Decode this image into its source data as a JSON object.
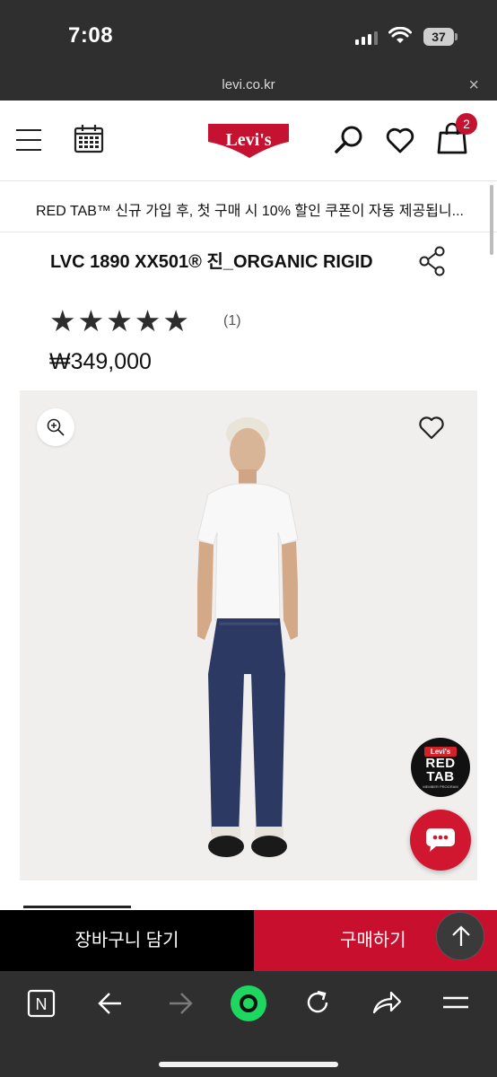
{
  "status_bar": {
    "time": "7:08",
    "battery": "37"
  },
  "url_bar": {
    "domain": "levi.co.kr",
    "close": "×"
  },
  "header": {
    "logo_text": "Levi's",
    "cart_count": "2"
  },
  "promo": {
    "text": "RED TAB™ 신규 가입 후, 첫 구매 시 10% 할인 쿠폰이 자동 제공됩니..."
  },
  "product": {
    "title": "LVC 1890 XX501® 진_ORGANIC RIGID",
    "rating": 5,
    "stars": [
      "★",
      "★",
      "★",
      "★",
      "★"
    ],
    "review_count": "(1)",
    "price": "₩349,000"
  },
  "badges": {
    "redtab_top": "Levi's",
    "redtab_main_1": "RED",
    "redtab_main_2": "TAB",
    "redtab_sub": "MEMBER PROGRAM"
  },
  "actions": {
    "cart_label": "장바구니 담기",
    "buy_label": "구매하기"
  },
  "colors": {
    "brand_red": "#c8102e",
    "dark_bar": "#2f2f2f",
    "browser_green": "#1ed760"
  },
  "browser_toolbar": {
    "icons": [
      "notion-icon",
      "back-arrow-icon",
      "forward-arrow-icon",
      "record-icon",
      "reload-icon",
      "share-icon",
      "menu-icon"
    ],
    "notion_letter": "N"
  }
}
